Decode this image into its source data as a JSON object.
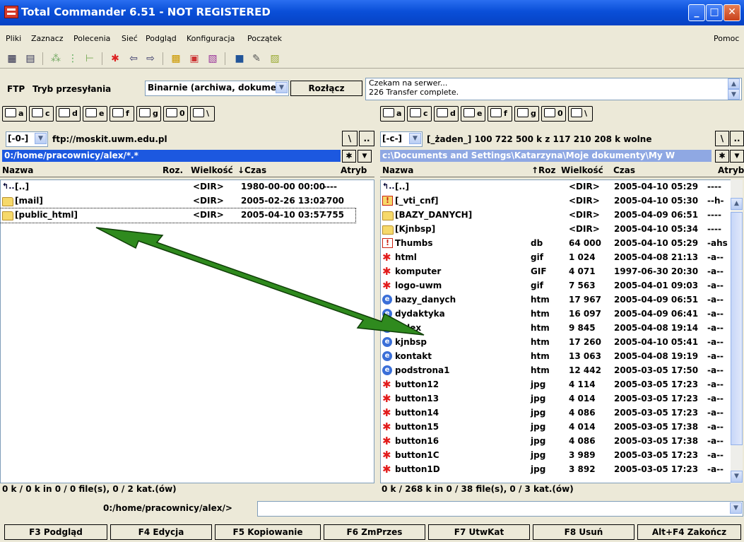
{
  "window": {
    "title": "Total Commander 6.51 - NOT REGISTERED"
  },
  "menu": [
    "Pliki",
    "Zaznacz",
    "Polecenia",
    "Sieć",
    "Podgląd",
    "Konfiguracja",
    "Początek"
  ],
  "menu_help": "Pomoc",
  "ftp": {
    "label": "FTP",
    "mode_label": "Tryb przesyłania",
    "mode_value": "Binarnie (archiwa, dokumen",
    "disconnect": "Rozłącz",
    "log": [
      "Czekam na serwer...",
      "226 Transfer complete."
    ]
  },
  "drives": [
    "a",
    "c",
    "d",
    "e",
    "f",
    "g",
    "0",
    "\\"
  ],
  "left": {
    "drive": "[-0-]",
    "location": "ftp://moskit.uwm.edu.pl",
    "path": "0:/home/pracownicy/alex/*.*",
    "columns": [
      "Nazwa",
      "Roz.",
      "Wielkość",
      "↓Czas",
      "Atryb"
    ],
    "rows": [
      {
        "icon": "up",
        "name": "[..]",
        "ext": "",
        "size": "<DIR>",
        "date": "1980-00-00 00:00",
        "attr": "----"
      },
      {
        "icon": "folder",
        "name": "[mail]",
        "ext": "",
        "size": "<DIR>",
        "date": "2005-02-26 13:02",
        "attr": "-700"
      },
      {
        "icon": "folder",
        "name": "[public_html]",
        "ext": "",
        "size": "<DIR>",
        "date": "2005-04-10 03:57",
        "attr": "-755"
      }
    ],
    "status": "0 k / 0 k in 0 / 0 file(s), 0 / 2 kat.(ów)"
  },
  "right": {
    "drive": "[-c-]",
    "location": "[_żaden_]  100 722 500 k z 117 210 208 k wolne",
    "path": "c:\\Documents and Settings\\Katarzyna\\Moje dokumenty\\My W",
    "columns": [
      "Nazwa",
      "↑Roz",
      "Wielkość",
      "Czas",
      "Atryb"
    ],
    "rows": [
      {
        "icon": "up",
        "name": "[..]",
        "ext": "",
        "size": "<DIR>",
        "date": "2005-04-10 05:29",
        "attr": "----"
      },
      {
        "icon": "excl-folder",
        "name": "[_vti_cnf]",
        "ext": "",
        "size": "<DIR>",
        "date": "2005-04-10 05:30",
        "attr": "--h-"
      },
      {
        "icon": "folder",
        "name": "[BAZY_DANYCH]",
        "ext": "",
        "size": "<DIR>",
        "date": "2005-04-09 06:51",
        "attr": "----"
      },
      {
        "icon": "folder",
        "name": "[Kjnbsp]",
        "ext": "",
        "size": "<DIR>",
        "date": "2005-04-10 05:34",
        "attr": "----"
      },
      {
        "icon": "excl",
        "name": "Thumbs",
        "ext": "db",
        "size": "64 000",
        "date": "2005-04-10 05:29",
        "attr": "-ahs"
      },
      {
        "icon": "star",
        "name": "html",
        "ext": "gif",
        "size": "1 024",
        "date": "2005-04-08 21:13",
        "attr": "-a--"
      },
      {
        "icon": "star",
        "name": "komputer",
        "ext": "GIF",
        "size": "4 071",
        "date": "1997-06-30 20:30",
        "attr": "-a--"
      },
      {
        "icon": "star",
        "name": "logo-uwm",
        "ext": "gif",
        "size": "7 563",
        "date": "2005-04-01 09:03",
        "attr": "-a--"
      },
      {
        "icon": "ie",
        "name": "bazy_danych",
        "ext": "htm",
        "size": "17 967",
        "date": "2005-04-09 06:51",
        "attr": "-a--"
      },
      {
        "icon": "ie",
        "name": "dydaktyka",
        "ext": "htm",
        "size": "16 097",
        "date": "2005-04-09 06:41",
        "attr": "-a--"
      },
      {
        "icon": "ie",
        "name": "index",
        "ext": "htm",
        "size": "9 845",
        "date": "2005-04-08 19:14",
        "attr": "-a--"
      },
      {
        "icon": "ie",
        "name": "kjnbsp",
        "ext": "htm",
        "size": "17 260",
        "date": "2005-04-10 05:41",
        "attr": "-a--"
      },
      {
        "icon": "ie",
        "name": "kontakt",
        "ext": "htm",
        "size": "13 063",
        "date": "2005-04-08 19:19",
        "attr": "-a--"
      },
      {
        "icon": "ie",
        "name": "podstrona1",
        "ext": "htm",
        "size": "12 442",
        "date": "2005-03-05 17:50",
        "attr": "-a--"
      },
      {
        "icon": "star",
        "name": "button12",
        "ext": "jpg",
        "size": "4 114",
        "date": "2005-03-05 17:23",
        "attr": "-a--"
      },
      {
        "icon": "star",
        "name": "button13",
        "ext": "jpg",
        "size": "4 014",
        "date": "2005-03-05 17:23",
        "attr": "-a--"
      },
      {
        "icon": "star",
        "name": "button14",
        "ext": "jpg",
        "size": "4 086",
        "date": "2005-03-05 17:23",
        "attr": "-a--"
      },
      {
        "icon": "star",
        "name": "button15",
        "ext": "jpg",
        "size": "4 014",
        "date": "2005-03-05 17:38",
        "attr": "-a--"
      },
      {
        "icon": "star",
        "name": "button16",
        "ext": "jpg",
        "size": "4 086",
        "date": "2005-03-05 17:38",
        "attr": "-a--"
      },
      {
        "icon": "star",
        "name": "button1C",
        "ext": "jpg",
        "size": "3 989",
        "date": "2005-03-05 17:23",
        "attr": "-a--"
      },
      {
        "icon": "star",
        "name": "button1D",
        "ext": "jpg",
        "size": "3 892",
        "date": "2005-03-05 17:23",
        "attr": "-a--"
      }
    ],
    "status": "0 k / 268 k in 0 / 38 file(s), 0 / 3 kat.(ów)"
  },
  "command_path": "0:/home/pracownicy/alex/>",
  "fkeys": [
    "F3 Podgląd",
    "F4 Edycja",
    "F5 Kopiowanie",
    "F6 ZmPrzes",
    "F7 UtwKat",
    "F8 Usuń",
    "Alt+F4 Zakończ"
  ],
  "colors": {
    "titlebar": "#0a4fd8",
    "active_path": "#1c58e0",
    "inactive_path": "#8fa8e3",
    "arrow": "#2f8a1e"
  }
}
